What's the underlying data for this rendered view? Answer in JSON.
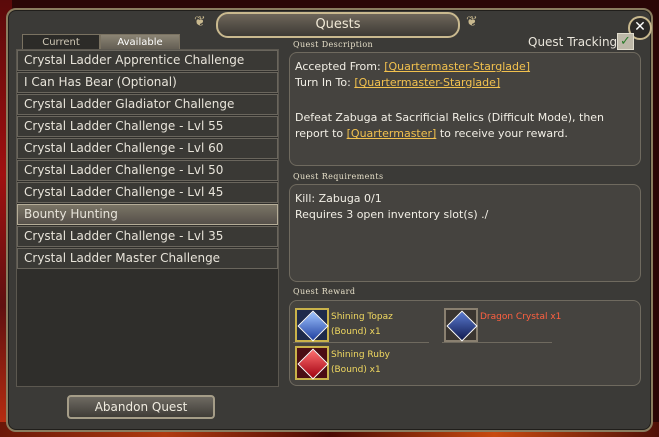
{
  "window": {
    "title": "Quests"
  },
  "tabs": [
    {
      "label": "Current"
    },
    {
      "label": "Available"
    }
  ],
  "quests": [
    "Crystal Ladder Apprentice Challenge",
    "I Can Has Bear (Optional)",
    "Crystal Ladder Gladiator Challenge",
    "Crystal Ladder Challenge - Lvl 55",
    "Crystal Ladder Challenge - Lvl 60",
    "Crystal Ladder Challenge - Lvl 50",
    "Crystal Ladder Challenge - Lvl 45",
    "Bounty Hunting",
    "Crystal Ladder Challenge - Lvl 35",
    "Crystal Ladder Master Challenge"
  ],
  "abandon_label": "Abandon Quest",
  "tracking": {
    "label": "Quest Tracking",
    "checked": true
  },
  "description": {
    "heading": "Quest Description",
    "accepted_from_label": "Accepted From:",
    "accepted_from": "[Quartermaster-Starglade]",
    "turn_in_label": "Turn In To:",
    "turn_in": "[Quartermaster-Starglade]",
    "body_line1": "Defeat Zabuga at Sacrificial Relics (Difficult Mode), then",
    "body_line2_pre": "report to",
    "body_link": "[Quartermaster]",
    "body_line2_post": "to receive your reward."
  },
  "requirements": {
    "heading": "Quest Requirements",
    "kill": "Kill: Zabuga 0/1",
    "slots": "Requires 3 open inventory slot(s)  ./"
  },
  "reward": {
    "heading": "Quest Reward",
    "items": [
      {
        "line1": "Shining Topaz",
        "line2": "(Bound) x1",
        "icon": "blue-gem-icon"
      },
      {
        "line1": "Dragon Crystal x1",
        "icon": "blue-crystal-icon"
      },
      {
        "line1": "Shining Ruby",
        "line2": "(Bound) x1",
        "icon": "red-gem-icon"
      }
    ]
  },
  "colors": {
    "link": "#f2c14e",
    "reward_text": "#f0d860",
    "reward_special": "#ff6040"
  }
}
